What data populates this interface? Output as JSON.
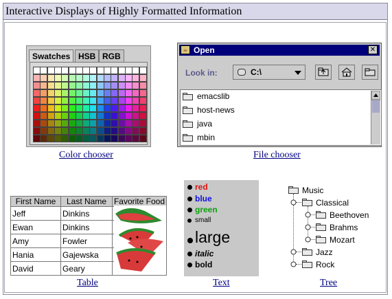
{
  "window": {
    "title": "Interactive Displays of Highly Formatted Information"
  },
  "color_chooser": {
    "tabs": [
      "Swatches",
      "HSB",
      "RGB"
    ],
    "active_tab": "Swatches",
    "caption": "Color chooser"
  },
  "file_chooser": {
    "dialog_title": "Open",
    "look_in_label": "Look in:",
    "look_in_value": "C:\\",
    "items": [
      "emacslib",
      "host-news",
      "java",
      "mbin"
    ],
    "caption": "File chooser",
    "icons": [
      "up-folder-icon",
      "home-icon",
      "new-folder-icon"
    ]
  },
  "table": {
    "headers": [
      "First Name",
      "Last Name",
      "Favorite Food"
    ],
    "rows": [
      [
        "Jeff",
        "Dinkins"
      ],
      [
        "Ewan",
        "Dinkins"
      ],
      [
        "Amy",
        "Fowler"
      ],
      [
        "Hania",
        "Gajewska"
      ],
      [
        "David",
        "Geary"
      ]
    ],
    "caption": "Table"
  },
  "text": {
    "lines": [
      {
        "text": "red",
        "color": "#e01010"
      },
      {
        "text": "blue",
        "color": "#1010e0"
      },
      {
        "text": "green",
        "color": "#10a010"
      },
      {
        "text": "small",
        "color": "#000000"
      },
      {
        "text": "large",
        "color": "#000000"
      },
      {
        "text": "italic",
        "color": "#000000"
      },
      {
        "text": "bold",
        "color": "#000000"
      }
    ],
    "caption": "Text"
  },
  "tree": {
    "root": "Music",
    "nodes": [
      "Classical",
      "Beethoven",
      "Brahms",
      "Mozart",
      "Jazz",
      "Rock"
    ],
    "caption": "Tree"
  }
}
